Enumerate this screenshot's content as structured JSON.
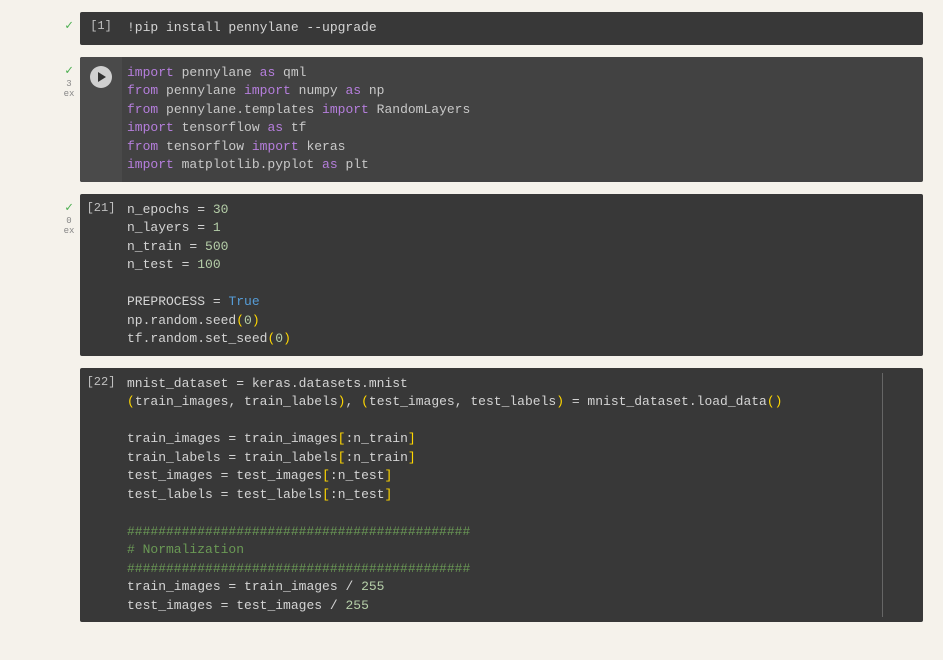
{
  "cells": [
    {
      "id": 0,
      "exec_count": "[1]",
      "status": "ok",
      "lines": [
        [
          {
            "t": "!pip install pennylane --upgrade",
            "c": "ident"
          }
        ]
      ]
    },
    {
      "id": 1,
      "active": true,
      "status": "ok",
      "meta1": "3",
      "meta2": "ex",
      "lines": [
        [
          {
            "t": "import",
            "c": "kw"
          },
          {
            "t": " pennylane ",
            "c": "mod"
          },
          {
            "t": "as",
            "c": "kw"
          },
          {
            "t": " qml",
            "c": "mod"
          }
        ],
        [
          {
            "t": "from",
            "c": "kw"
          },
          {
            "t": " pennylane ",
            "c": "mod"
          },
          {
            "t": "import",
            "c": "kw"
          },
          {
            "t": " numpy ",
            "c": "mod"
          },
          {
            "t": "as",
            "c": "kw"
          },
          {
            "t": " np",
            "c": "mod"
          }
        ],
        [
          {
            "t": "from",
            "c": "kw"
          },
          {
            "t": " pennylane.templates ",
            "c": "mod"
          },
          {
            "t": "import",
            "c": "kw"
          },
          {
            "t": " RandomLayers",
            "c": "mod"
          }
        ],
        [
          {
            "t": "import",
            "c": "kw"
          },
          {
            "t": " tensorflow ",
            "c": "mod"
          },
          {
            "t": "as",
            "c": "kw"
          },
          {
            "t": " tf",
            "c": "mod"
          }
        ],
        [
          {
            "t": "from",
            "c": "kw"
          },
          {
            "t": " tensorflow ",
            "c": "mod"
          },
          {
            "t": "import",
            "c": "kw"
          },
          {
            "t": " keras",
            "c": "mod"
          }
        ],
        [
          {
            "t": "import",
            "c": "kw"
          },
          {
            "t": " matplotlib.pyplot ",
            "c": "mod"
          },
          {
            "t": "as",
            "c": "kw"
          },
          {
            "t": " plt",
            "c": "mod"
          }
        ]
      ]
    },
    {
      "id": 2,
      "exec_count": "[21]",
      "status": "ok",
      "meta1": "0",
      "meta2": "ex",
      "lines": [
        [
          {
            "t": "n_epochs ",
            "c": "ident"
          },
          {
            "t": "=",
            "c": "op"
          },
          {
            "t": " ",
            "c": "ident"
          },
          {
            "t": "30",
            "c": "num"
          }
        ],
        [
          {
            "t": "n_layers ",
            "c": "ident"
          },
          {
            "t": "=",
            "c": "op"
          },
          {
            "t": " ",
            "c": "ident"
          },
          {
            "t": "1",
            "c": "num"
          }
        ],
        [
          {
            "t": "n_train ",
            "c": "ident"
          },
          {
            "t": "=",
            "c": "op"
          },
          {
            "t": " ",
            "c": "ident"
          },
          {
            "t": "500",
            "c": "num"
          }
        ],
        [
          {
            "t": "n_test ",
            "c": "ident"
          },
          {
            "t": "=",
            "c": "op"
          },
          {
            "t": " ",
            "c": "ident"
          },
          {
            "t": "100",
            "c": "num"
          }
        ],
        [
          {
            "t": "",
            "c": "ident"
          }
        ],
        [
          {
            "t": "PREPROCESS ",
            "c": "ident"
          },
          {
            "t": "=",
            "c": "op"
          },
          {
            "t": " ",
            "c": "ident"
          },
          {
            "t": "True",
            "c": "bool"
          }
        ],
        [
          {
            "t": "np.random.seed",
            "c": "ident"
          },
          {
            "t": "(",
            "c": "paren"
          },
          {
            "t": "0",
            "c": "num"
          },
          {
            "t": ")",
            "c": "paren"
          }
        ],
        [
          {
            "t": "tf.random.set_seed",
            "c": "ident"
          },
          {
            "t": "(",
            "c": "paren"
          },
          {
            "t": "0",
            "c": "num"
          },
          {
            "t": ")",
            "c": "paren"
          }
        ]
      ]
    },
    {
      "id": 3,
      "exec_count": "[22]",
      "show_scroll_ind": true,
      "lines": [
        [
          {
            "t": "mnist_dataset ",
            "c": "ident"
          },
          {
            "t": "=",
            "c": "op"
          },
          {
            "t": " keras.datasets.mnist",
            "c": "ident"
          }
        ],
        [
          {
            "t": "(",
            "c": "paren"
          },
          {
            "t": "train_images",
            "c": "ident"
          },
          {
            "t": ",",
            "c": "op"
          },
          {
            "t": " train_labels",
            "c": "ident"
          },
          {
            "t": ")",
            "c": "paren"
          },
          {
            "t": ",",
            "c": "op"
          },
          {
            "t": " ",
            "c": "ident"
          },
          {
            "t": "(",
            "c": "paren"
          },
          {
            "t": "test_images",
            "c": "ident"
          },
          {
            "t": ",",
            "c": "op"
          },
          {
            "t": " test_labels",
            "c": "ident"
          },
          {
            "t": ")",
            "c": "paren"
          },
          {
            "t": " ",
            "c": "ident"
          },
          {
            "t": "=",
            "c": "op"
          },
          {
            "t": " mnist_dataset.load_data",
            "c": "ident"
          },
          {
            "t": "(",
            "c": "paren"
          },
          {
            "t": ")",
            "c": "paren"
          }
        ],
        [
          {
            "t": "",
            "c": "ident"
          }
        ],
        [
          {
            "t": "train_images ",
            "c": "ident"
          },
          {
            "t": "=",
            "c": "op"
          },
          {
            "t": " train_images",
            "c": "ident"
          },
          {
            "t": "[",
            "c": "paren"
          },
          {
            "t": ":",
            "c": "op"
          },
          {
            "t": "n_train",
            "c": "ident"
          },
          {
            "t": "]",
            "c": "paren"
          }
        ],
        [
          {
            "t": "train_labels ",
            "c": "ident"
          },
          {
            "t": "=",
            "c": "op"
          },
          {
            "t": " train_labels",
            "c": "ident"
          },
          {
            "t": "[",
            "c": "paren"
          },
          {
            "t": ":",
            "c": "op"
          },
          {
            "t": "n_train",
            "c": "ident"
          },
          {
            "t": "]",
            "c": "paren"
          }
        ],
        [
          {
            "t": "test_images ",
            "c": "ident"
          },
          {
            "t": "=",
            "c": "op"
          },
          {
            "t": " test_images",
            "c": "ident"
          },
          {
            "t": "[",
            "c": "paren"
          },
          {
            "t": ":",
            "c": "op"
          },
          {
            "t": "n_test",
            "c": "ident"
          },
          {
            "t": "]",
            "c": "paren"
          }
        ],
        [
          {
            "t": "test_labels ",
            "c": "ident"
          },
          {
            "t": "=",
            "c": "op"
          },
          {
            "t": " test_labels",
            "c": "ident"
          },
          {
            "t": "[",
            "c": "paren"
          },
          {
            "t": ":",
            "c": "op"
          },
          {
            "t": "n_test",
            "c": "ident"
          },
          {
            "t": "]",
            "c": "paren"
          }
        ],
        [
          {
            "t": "",
            "c": "ident"
          }
        ],
        [
          {
            "t": "############################################",
            "c": "comment"
          }
        ],
        [
          {
            "t": "# Normalization",
            "c": "comment"
          }
        ],
        [
          {
            "t": "############################################",
            "c": "comment"
          }
        ],
        [
          {
            "t": "train_images ",
            "c": "ident"
          },
          {
            "t": "=",
            "c": "op"
          },
          {
            "t": " train_images ",
            "c": "ident"
          },
          {
            "t": "/",
            "c": "op"
          },
          {
            "t": " ",
            "c": "ident"
          },
          {
            "t": "255",
            "c": "num"
          }
        ],
        [
          {
            "t": "test_images ",
            "c": "ident"
          },
          {
            "t": "=",
            "c": "op"
          },
          {
            "t": " test_images ",
            "c": "ident"
          },
          {
            "t": "/",
            "c": "op"
          },
          {
            "t": " ",
            "c": "ident"
          },
          {
            "t": "255",
            "c": "num"
          }
        ]
      ]
    }
  ]
}
